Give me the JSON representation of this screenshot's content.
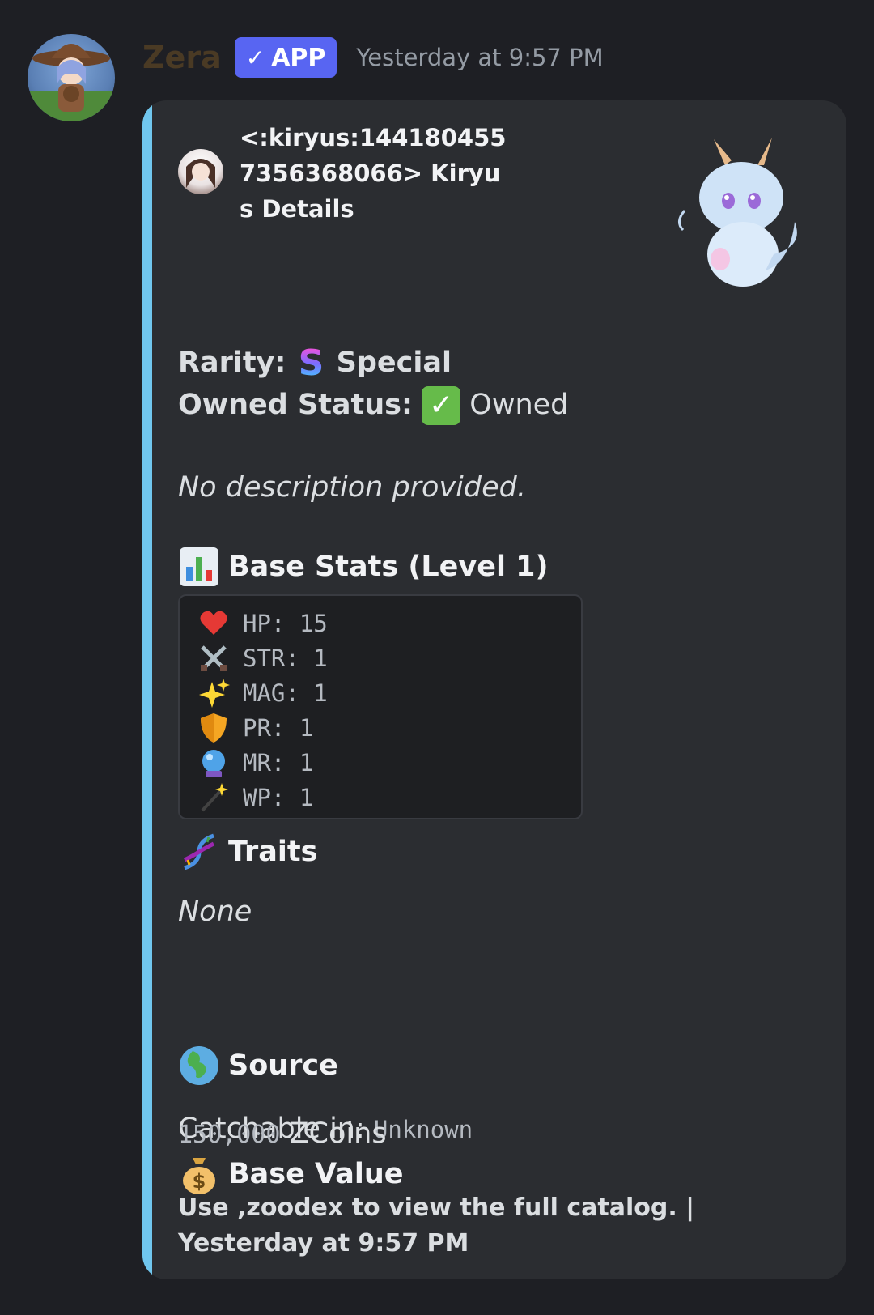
{
  "message": {
    "author": "Zera",
    "badge": "APP",
    "timestamp": "Yesterday at 9:57 PM"
  },
  "embed": {
    "title": "<:kiryus:1441804557356368066> Kiryus Details",
    "rarity_label": "Rarity:",
    "rarity_value": "Special",
    "owned_label": "Owned Status:",
    "owned_value": "Owned",
    "description": "No description provided.",
    "stats_heading": "Base Stats (Level 1)",
    "stats": [
      {
        "icon": "heart-icon",
        "text": "HP: 15"
      },
      {
        "icon": "crossed-swords-icon",
        "text": "STR: 1"
      },
      {
        "icon": "sparkles-icon",
        "text": "MAG: 1"
      },
      {
        "icon": "shield-icon",
        "text": "PR: 1"
      },
      {
        "icon": "crystal-ball-icon",
        "text": "MR: 1"
      },
      {
        "icon": "magic-wand-icon",
        "text": "WP: 1"
      }
    ],
    "traits_heading": "Traits",
    "traits_value": "None",
    "source_heading": "Source",
    "catchable_label": "Catchable in:",
    "catchable_value": "Unknown",
    "value_heading": "Base Value",
    "value_amount": "150,000",
    "value_currency": "ZCoins",
    "footer": "Use ,zoodex to view the full catalog. | Yesterday at 9:57 PM",
    "accent_color": "#70c6ee"
  },
  "colors": {
    "background": "#1e1f24",
    "embed_background": "#2b2d31",
    "badge": "#5865f2"
  }
}
